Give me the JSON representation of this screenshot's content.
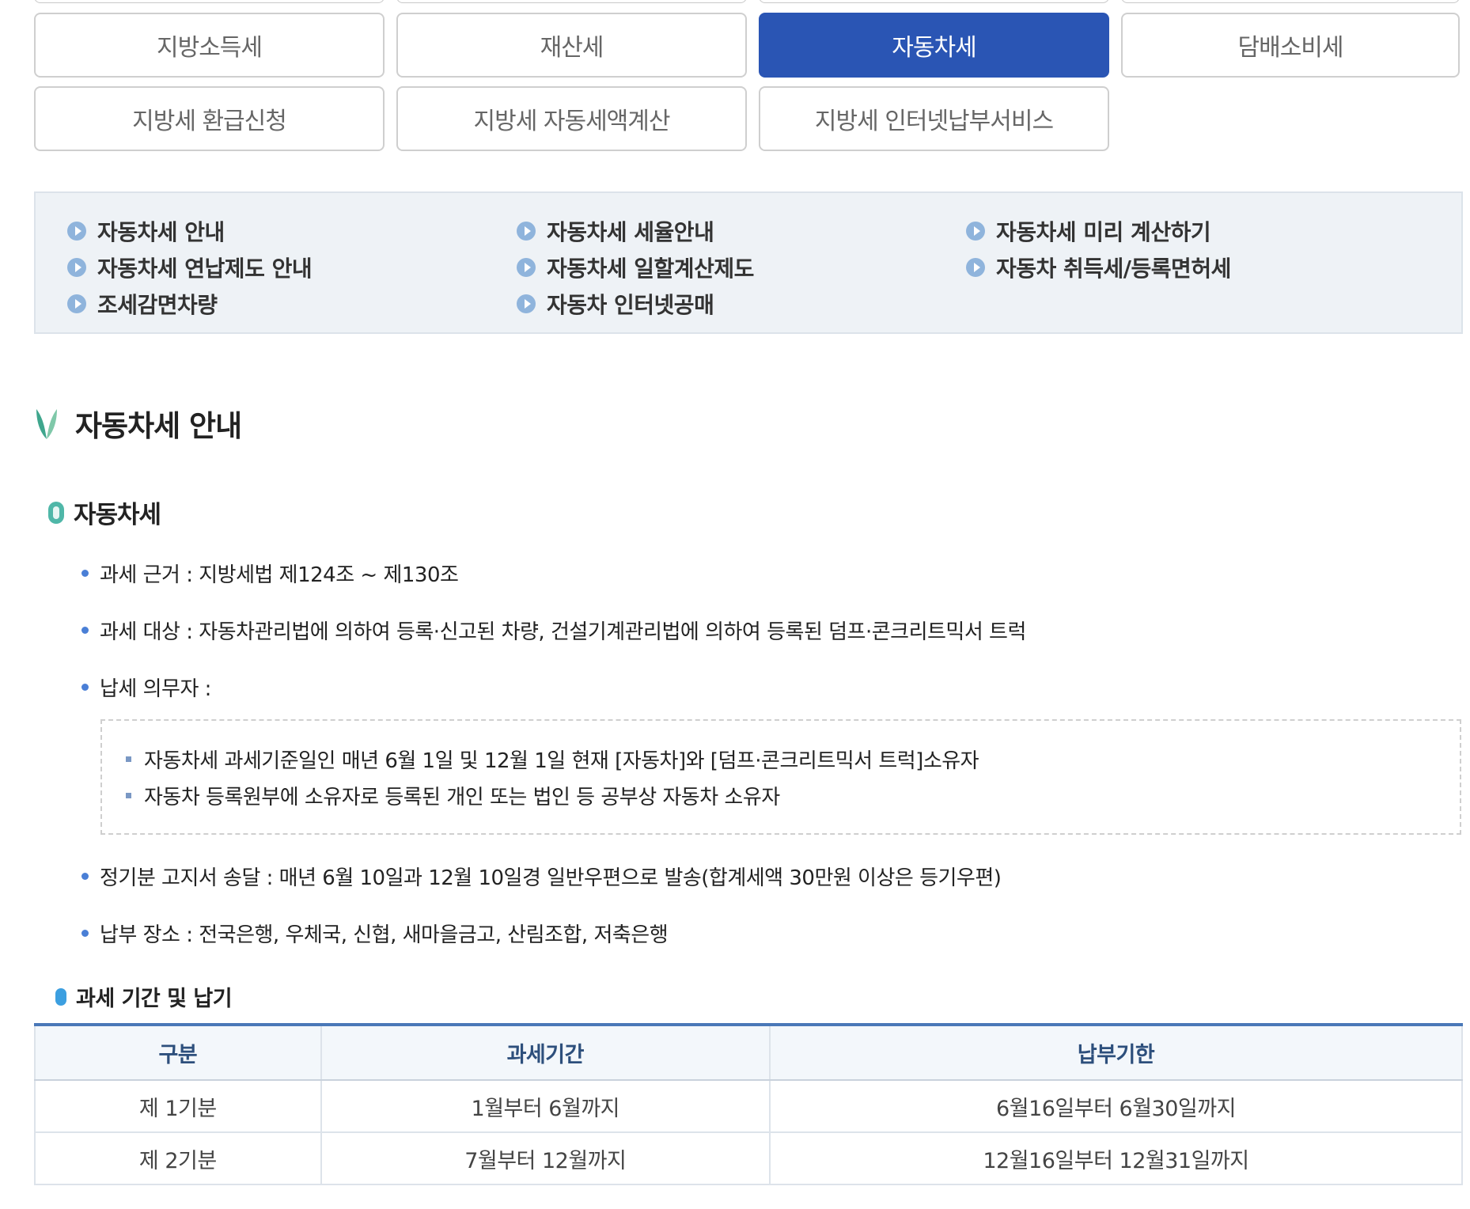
{
  "tabs": [
    {
      "label": "지방소득세",
      "active": false
    },
    {
      "label": "재산세",
      "active": false
    },
    {
      "label": "자동차세",
      "active": true
    },
    {
      "label": "담배소비세",
      "active": false
    },
    {
      "label": "지방세 환급신청",
      "active": false
    },
    {
      "label": "지방세 자동세액계산",
      "active": false
    },
    {
      "label": "지방세 인터넷납부서비스",
      "active": false
    }
  ],
  "sublinks": [
    {
      "label": "자동차세 안내"
    },
    {
      "label": "자동차세 연납제도 안내"
    },
    {
      "label": "조세감면차량"
    },
    {
      "label": "자동차세 세율안내"
    },
    {
      "label": "자동차세 일할계산제도"
    },
    {
      "label": "자동차 인터넷공매"
    },
    {
      "label": "자동차세 미리 계산하기"
    },
    {
      "label": "자동차 취득세/등록면허세"
    }
  ],
  "section": {
    "title": "자동차세 안내",
    "subtitle": "자동차세",
    "bullets": [
      "과세 근거 : 지방세법 제124조 ~ 제130조",
      "과세 대상 : 자동차관리법에 의하여 등록·신고된 차량, 건설기계관리법에 의하여 등록된 덤프·콘크리트믹서 트럭",
      "납세 의무자 :",
      "정기분 고지서 송달 : 매년 6월 10일과 12월 10일경 일반우편으로 발송(합계세액 30만원 이상은 등기우편)",
      "납부 장소 : 전국은행, 우체국, 신협, 새마을금고, 산림조합, 저축은행"
    ],
    "taxpayer_items": [
      "자동차세 과세기준일인 매년 6월 1일 및 12월 1일 현재 [자동차]와 [덤프·콘크리트믹서 트럭]소유자",
      "자동차 등록원부에 소유자로 등록된 개인 또는 법인 등 공부상 자동차 소유자"
    ]
  },
  "schedule": {
    "title": "과세 기간 및 납기",
    "headers": [
      "구분",
      "과세기간",
      "납부기한"
    ],
    "rows": [
      [
        "제 1기분",
        "1월부터 6월까지",
        "6월16일부터 6월30일까지"
      ],
      [
        "제 2기분",
        "7월부터 12월까지",
        "12월16일부터 12월31일까지"
      ]
    ]
  },
  "colors": {
    "active_tab": "#2a55b4",
    "sublink_bg": "#eef2f6",
    "table_accent": "#4a78b8",
    "leaf": "#3fa68d"
  }
}
